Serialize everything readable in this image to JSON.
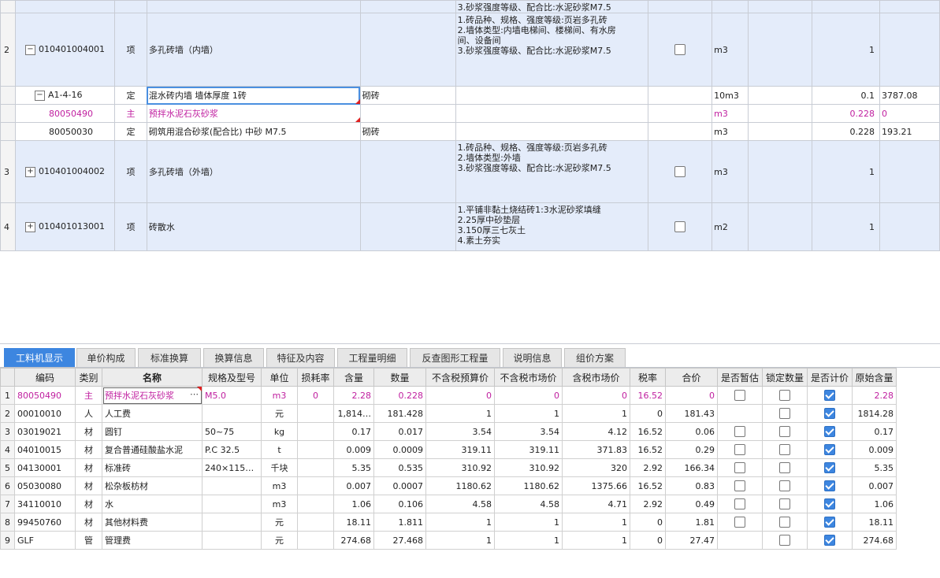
{
  "upper": {
    "top_fragment": "3.砂浆强度等级、配合比:水泥砂浆M7.5",
    "rows": [
      {
        "rn": "2",
        "code": "010401004001",
        "type": "项",
        "name": "多孔砖墙（内墙）",
        "feature": "",
        "desc": "1.砖品种、规格、强度等级:页岩多孔砖\n2.墙体类型:内墙电梯间、楼梯间、有水房\n间、设备间\n3.砂浆强度等级、配合比:水泥砂浆M7.5",
        "unit": "m3",
        "qty": "1",
        "price": "",
        "toggle": "−"
      },
      {
        "rn": "",
        "code": "A1-4-16",
        "type": "定",
        "name": "混水砖内墙 墙体厚度 1砖",
        "feature": "砌砖",
        "desc": "",
        "unit": "10m3",
        "qty": "0.1",
        "price": "3787.08",
        "toggle": "−"
      },
      {
        "rn": "",
        "code": "80050490",
        "type": "主",
        "name": "预拌水泥石灰砂浆",
        "feature": "",
        "desc": "",
        "unit": "m3",
        "qty": "0.228",
        "price": "0",
        "toggle": ""
      },
      {
        "rn": "",
        "code": "80050030",
        "type": "定",
        "name": "砌筑用混合砂浆(配合比) 中砂 M7.5",
        "feature": "砌砖",
        "desc": "",
        "unit": "m3",
        "qty": "0.228",
        "price": "193.21",
        "toggle": ""
      },
      {
        "rn": "3",
        "code": "010401004002",
        "type": "项",
        "name": "多孔砖墙（外墙）",
        "feature": "",
        "desc": "1.砖品种、规格、强度等级:页岩多孔砖\n2.墙体类型:外墙\n3.砂浆强度等级、配合比:水泥砂浆M7.5",
        "unit": "m3",
        "qty": "1",
        "price": "",
        "toggle": "+"
      },
      {
        "rn": "4",
        "code": "010401013001",
        "type": "项",
        "name": "砖散水",
        "feature": "",
        "desc": "1.平铺非黏土烧结砖1:3水泥砂浆填缝\n2.25厚中砂垫层\n3.150厚三七灰土\n4.素土夯实",
        "unit": "m2",
        "qty": "1",
        "price": "",
        "toggle": "+"
      }
    ]
  },
  "tabs": [
    "工料机显示",
    "单价构成",
    "标准换算",
    "换算信息",
    "特征及内容",
    "工程量明细",
    "反查图形工程量",
    "说明信息",
    "组价方案"
  ],
  "lower": {
    "headers": [
      "编码",
      "类别",
      "名称",
      "规格及型号",
      "单位",
      "损耗率",
      "含量",
      "数量",
      "不含税预算价",
      "不含税市场价",
      "含税市场价",
      "税率",
      "合价",
      "是否暂估",
      "锁定数量",
      "是否计价",
      "原始含量"
    ],
    "rows": [
      {
        "rn": "1",
        "code": "80050490",
        "cat": "主",
        "name": "预拌水泥石灰砂浆",
        "spec": "M5.0",
        "unit": "m3",
        "loss": "0",
        "content": "2.28",
        "qty": "0.228",
        "p1": "0",
        "p2": "0",
        "p3": "0",
        "tax": "16.52",
        "total": "0",
        "zg": false,
        "lock": false,
        "jj": true,
        "orig": "2.28"
      },
      {
        "rn": "2",
        "code": "00010010",
        "cat": "人",
        "name": "人工费",
        "spec": "",
        "unit": "元",
        "loss": "",
        "content": "1,814…",
        "qty": "181.428",
        "p1": "1",
        "p2": "1",
        "p3": "1",
        "tax": "0",
        "total": "181.43",
        "zg": null,
        "lock": false,
        "jj": true,
        "orig": "1814.28"
      },
      {
        "rn": "3",
        "code": "03019021",
        "cat": "材",
        "name": "圆钉",
        "spec": "50~75",
        "unit": "kg",
        "loss": "",
        "content": "0.17",
        "qty": "0.017",
        "p1": "3.54",
        "p2": "3.54",
        "p3": "4.12",
        "tax": "16.52",
        "total": "0.06",
        "zg": false,
        "lock": false,
        "jj": true,
        "orig": "0.17"
      },
      {
        "rn": "4",
        "code": "04010015",
        "cat": "材",
        "name": "复合普通硅酸盐水泥",
        "spec": "P.C 32.5",
        "unit": "t",
        "loss": "",
        "content": "0.009",
        "qty": "0.0009",
        "p1": "319.11",
        "p2": "319.11",
        "p3": "371.83",
        "tax": "16.52",
        "total": "0.29",
        "zg": false,
        "lock": false,
        "jj": true,
        "orig": "0.009"
      },
      {
        "rn": "5",
        "code": "04130001",
        "cat": "材",
        "name": "标准砖",
        "spec": "240×115…",
        "unit": "千块",
        "loss": "",
        "content": "5.35",
        "qty": "0.535",
        "p1": "310.92",
        "p2": "310.92",
        "p3": "320",
        "tax": "2.92",
        "total": "166.34",
        "zg": false,
        "lock": false,
        "jj": true,
        "orig": "5.35"
      },
      {
        "rn": "6",
        "code": "05030080",
        "cat": "材",
        "name": "松杂板枋材",
        "spec": "",
        "unit": "m3",
        "loss": "",
        "content": "0.007",
        "qty": "0.0007",
        "p1": "1180.62",
        "p2": "1180.62",
        "p3": "1375.66",
        "tax": "16.52",
        "total": "0.83",
        "zg": false,
        "lock": false,
        "jj": true,
        "orig": "0.007"
      },
      {
        "rn": "7",
        "code": "34110010",
        "cat": "材",
        "name": "水",
        "spec": "",
        "unit": "m3",
        "loss": "",
        "content": "1.06",
        "qty": "0.106",
        "p1": "4.58",
        "p2": "4.58",
        "p3": "4.71",
        "tax": "2.92",
        "total": "0.49",
        "zg": false,
        "lock": false,
        "jj": true,
        "orig": "1.06"
      },
      {
        "rn": "8",
        "code": "99450760",
        "cat": "材",
        "name": "其他材料费",
        "spec": "",
        "unit": "元",
        "loss": "",
        "content": "18.11",
        "qty": "1.811",
        "p1": "1",
        "p2": "1",
        "p3": "1",
        "tax": "0",
        "total": "1.81",
        "zg": false,
        "lock": false,
        "jj": true,
        "orig": "18.11"
      },
      {
        "rn": "9",
        "code": "GLF",
        "cat": "管",
        "name": "管理费",
        "spec": "",
        "unit": "元",
        "loss": "",
        "content": "274.68",
        "qty": "27.468",
        "p1": "1",
        "p2": "1",
        "p3": "1",
        "tax": "0",
        "total": "27.47",
        "zg": null,
        "lock": false,
        "jj": true,
        "orig": "274.68"
      }
    ]
  },
  "colors": {
    "accent": "#3d86e0",
    "qd_row": "#e4ecfa",
    "main_material": "#c020a0",
    "tree_line": "#e0a020"
  }
}
